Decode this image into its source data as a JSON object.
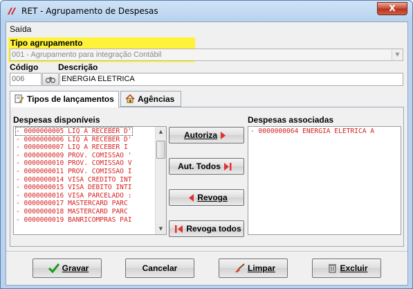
{
  "window": {
    "title": "RET - Agrupamento de Despesas",
    "close_label": "X"
  },
  "menu": {
    "items": [
      "Saída"
    ]
  },
  "form": {
    "tipo_label": "Tipo agrupamento",
    "tipo_value": "001 - Agrupamento para integração Contábil",
    "codigo_label": "Código",
    "codigo_value": "006",
    "descricao_label": "Descrição",
    "descricao_value": "ENERGIA ELETRICA"
  },
  "tabs": [
    {
      "label": "Tipos de lançamentos",
      "active": true
    },
    {
      "label": "Agências",
      "active": false
    }
  ],
  "available": {
    "label": "Despesas disponíveis",
    "items": [
      "- 0000000005 LIQ A RECEBER D'",
      "- 0000000006 LIQ A RECEBER D'",
      "- 0000000007 LIQ A RECEBER I",
      "- 0000000009 PROV. COMISSAO '",
      "- 0000000010 PROV. COMISSAO V",
      "- 0000000011 PROV. COMISSAO I",
      "- 0000000014 VISA CREDITO INT",
      "- 0000000015 VISA DEBITO INTI",
      "- 0000000016 VISA PARCELADO :",
      "- 0000000017 MASTERCARD PARC",
      "- 0000000018 MASTERCARD PARC",
      "- 0000000019 BANRICOMPRAS PAI"
    ]
  },
  "associated": {
    "label": "Despesas associadas",
    "items": [
      "- 0000000064 ENERGIA ELETRICA A"
    ]
  },
  "middle_buttons": {
    "autoriza": "Autoriza",
    "aut_todos": "Aut. Todos",
    "revoga": "Revoga",
    "revoga_todos": "Revoga todos"
  },
  "bottom_buttons": {
    "gravar": "Gravar",
    "cancelar": "Cancelar",
    "limpar": "Limpar",
    "excluir": "Excluir"
  },
  "colors": {
    "highlight": "#fff33a",
    "list_text": "#d62020",
    "arrow_red": "#e03030"
  }
}
